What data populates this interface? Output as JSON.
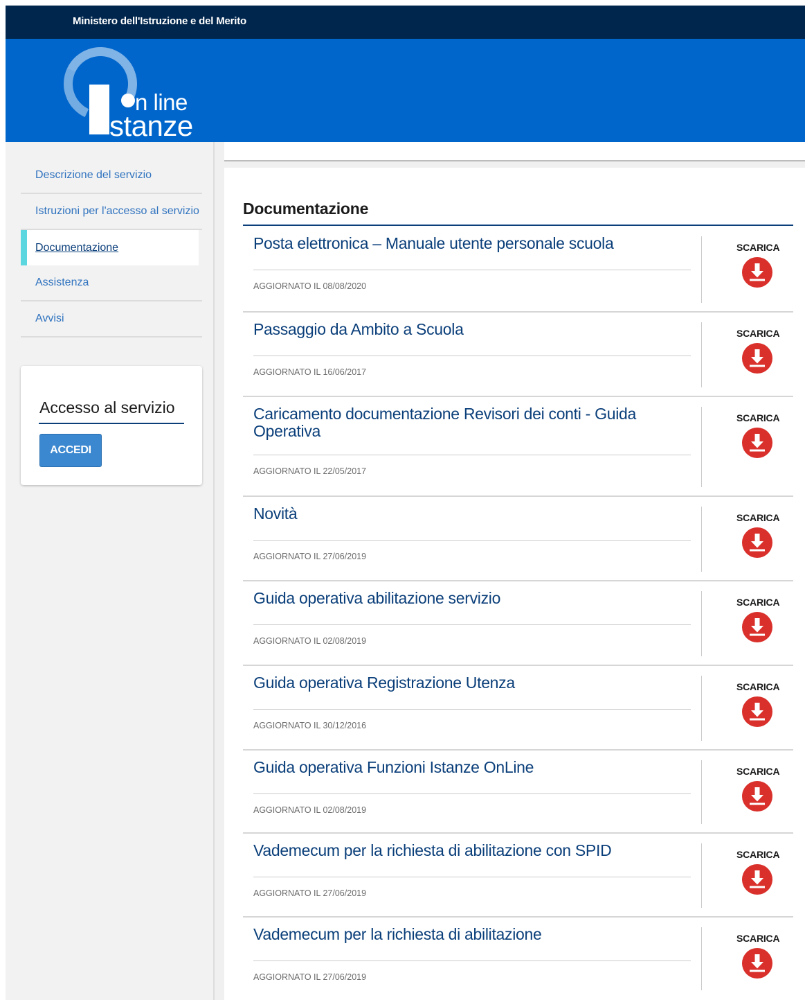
{
  "topbar": {
    "ministry": "Ministero dell'Istruzione e del Merito"
  },
  "logo": {
    "line1": "n line",
    "line2": "stanze"
  },
  "sidebar": {
    "items": [
      {
        "label": "Descrizione del servizio",
        "active": false
      },
      {
        "label": "Istruzioni per l'accesso al servizio",
        "active": false
      },
      {
        "label": "Documentazione",
        "active": true
      },
      {
        "label": "Assistenza",
        "active": false
      },
      {
        "label": "Avvisi",
        "active": false
      }
    ]
  },
  "access": {
    "title": "Accesso al servizio",
    "button_label": "ACCEDI"
  },
  "documentation": {
    "heading": "Documentazione",
    "download_label": "SCARICA",
    "items": [
      {
        "title": "Posta elettronica – Manuale utente personale scuola",
        "date": "AGGIORNATO IL 08/08/2020"
      },
      {
        "title": "Passaggio da Ambito a Scuola",
        "date": "AGGIORNATO IL 16/06/2017"
      },
      {
        "title": "Caricamento documentazione Revisori dei conti - Guida Operativa",
        "date": "AGGIORNATO IL 22/05/2017"
      },
      {
        "title": "Novità",
        "date": "AGGIORNATO IL 27/06/2019"
      },
      {
        "title": "Guida operativa abilitazione servizio",
        "date": "AGGIORNATO IL 02/08/2019"
      },
      {
        "title": "Guida operativa Registrazione Utenza",
        "date": "AGGIORNATO IL 30/12/2016"
      },
      {
        "title": "Guida operativa Funzioni Istanze OnLine",
        "date": "AGGIORNATO IL 02/08/2019"
      },
      {
        "title": "Vademecum per la richiesta di abilitazione con SPID",
        "date": "AGGIORNATO IL 27/06/2019"
      },
      {
        "title": "Vademecum per la richiesta di abilitazione",
        "date": "AGGIORNATO IL 27/06/2019"
      }
    ]
  },
  "colors": {
    "topbar": "#00264d",
    "header": "#0066cc",
    "link": "#3073bf",
    "title": "#0b3f7a",
    "download": "#d9302b",
    "active_marker": "#5cd6df"
  }
}
